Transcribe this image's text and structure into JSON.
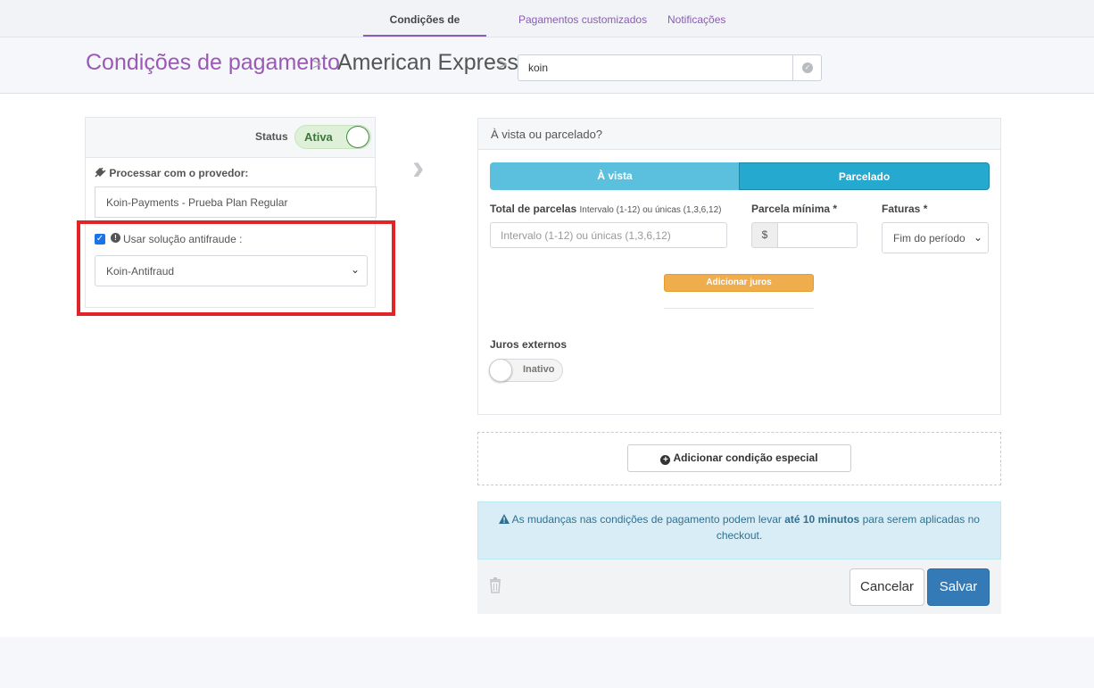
{
  "topnav": {
    "tabs": [
      {
        "label": "Condições de pagamento"
      },
      {
        "label": "Pagamentos customizados"
      },
      {
        "label": "Notificações"
      }
    ]
  },
  "header": {
    "breadcrumb_root": "Condições de pagamento",
    "breadcrumb_current": "American Express",
    "search_value": "koin"
  },
  "left": {
    "status_label": "Status",
    "status_toggle_label": "Ativa",
    "provider_label": "Processar com o provedor:",
    "provider_value": "Koin-Payments - Prueba Plan Regular",
    "antifraud_label": "Usar solução antifraude :",
    "antifraud_checked": true,
    "antifraud_value": "Koin-Antifraud"
  },
  "right": {
    "header_title": "À vista ou parcelado?",
    "segment_vista": "À vista",
    "segment_parcelado": "Parcelado",
    "total_parcelas_label": "Total de parcelas",
    "total_parcelas_hint": "Intervalo (1-12) ou únicas (1,3,6,12)",
    "total_parcelas_placeholder": "Intervalo (1-12) ou únicas (1,3,6,12)",
    "parcela_minima_label": "Parcela mínima",
    "currency_symbol": "$",
    "faturas_label": "Faturas",
    "faturas_value": "Fim do período",
    "required_marker": "*",
    "add_juros_button": "Adicionar juros",
    "juros_externos_label": "Juros externos",
    "juros_externos_toggle": "Inativo"
  },
  "special_condition_button": "Adicionar condição especial",
  "alert": {
    "text_before": "As mudanças nas condições de pagamento podem levar ",
    "text_bold": "até 10 minutos",
    "text_after": " para serem aplicadas no checkout."
  },
  "footer": {
    "cancel_label": "Cancelar",
    "save_label": "Salvar"
  },
  "colors": {
    "accent": "#9b59b6",
    "primary": "#337ab7",
    "info": "#5bc0de",
    "warning": "#f0ad4e",
    "highlight": "#e02427"
  }
}
